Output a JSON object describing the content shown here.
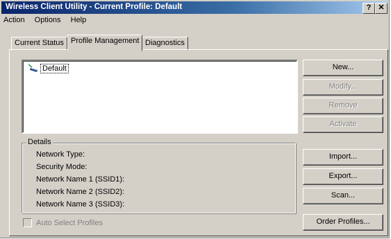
{
  "window": {
    "title": "Wireless Client Utility - Current Profile: Default",
    "help_glyph": "?",
    "close_glyph": "✕"
  },
  "menu": {
    "items": [
      "Action",
      "Options",
      "Help"
    ]
  },
  "tabs": [
    "Current Status",
    "Profile Management",
    "Diagnostics"
  ],
  "profiles": {
    "items": [
      "Default"
    ],
    "icon": "wireless-profile-icon"
  },
  "buttons": {
    "new": "New...",
    "modify": "Modify...",
    "remove": "Remove",
    "activate": "Activate",
    "import": "Import...",
    "export": "Export...",
    "scan": "Scan...",
    "order_profiles": "Order Profiles..."
  },
  "details": {
    "legend": "Details",
    "network_type": "Network Type:",
    "security_mode": "Security Mode:",
    "ssid1": "Network Name 1 (SSID1):",
    "ssid2": "Network Name 2 (SSID2):",
    "ssid3": "Network Name 3 (SSID3):"
  },
  "auto_select": {
    "label": "Auto Select Profiles"
  },
  "colors": {
    "title_start": "#0a246a",
    "title_end": "#a6caf0",
    "face": "#d4d0c8"
  }
}
